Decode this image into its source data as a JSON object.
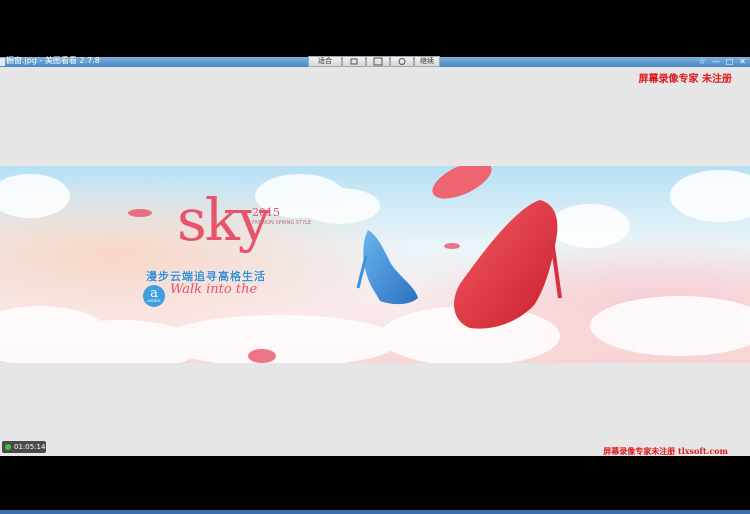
{
  "window": {
    "title": "橱窗.jpg - 美图看看 2.7.8",
    "toolbar": [
      "适合",
      "",
      "",
      "",
      "继续"
    ],
    "controls": [
      "☆",
      "—",
      "□",
      "✕"
    ]
  },
  "watermark_top": "屏幕录像专家 未注册",
  "watermark_bottom": "屏幕录像专家未注册 tlxsoft.com",
  "timer": "01:05:14",
  "banner": {
    "year": "2015",
    "headline": "sky",
    "tagline_cn": "漫步云端追寻高格生活",
    "tagline_en": "Walk into the",
    "badge": "a",
    "badge_sub": "ARIES",
    "small_text": "FASHION SPRING STYLE"
  },
  "colors": {
    "title_blue": "#5a92c8",
    "watermark_red": "#e01818",
    "sky_pink": "#e8526a",
    "shoe_red": "#e23a45",
    "shoe_blue": "#3f8fd6"
  }
}
